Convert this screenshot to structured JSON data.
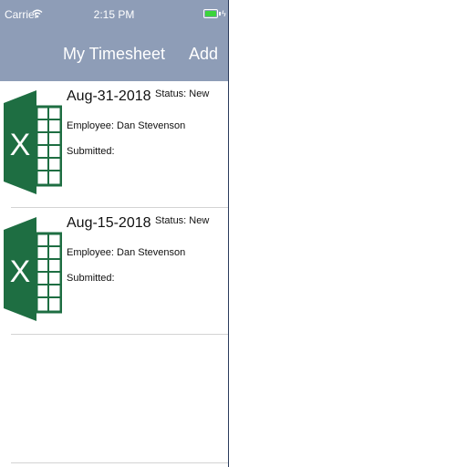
{
  "status_bar": {
    "carrier": "Carrier",
    "time": "2:15 PM",
    "battery_color": "#3bd43b"
  },
  "nav": {
    "title": "My Timesheet",
    "add_label": "Add",
    "bar_color": "#8e9db7"
  },
  "timesheets": [
    {
      "date": "Aug-31-2018",
      "status": "Status: New",
      "employee": "Employee: Dan Stevenson",
      "submitted": "Submitted:",
      "icon": "excel-icon"
    },
    {
      "date": "Aug-15-2018",
      "status": "Status: New",
      "employee": "Employee: Dan Stevenson",
      "submitted": "Submitted:",
      "icon": "excel-icon"
    }
  ]
}
